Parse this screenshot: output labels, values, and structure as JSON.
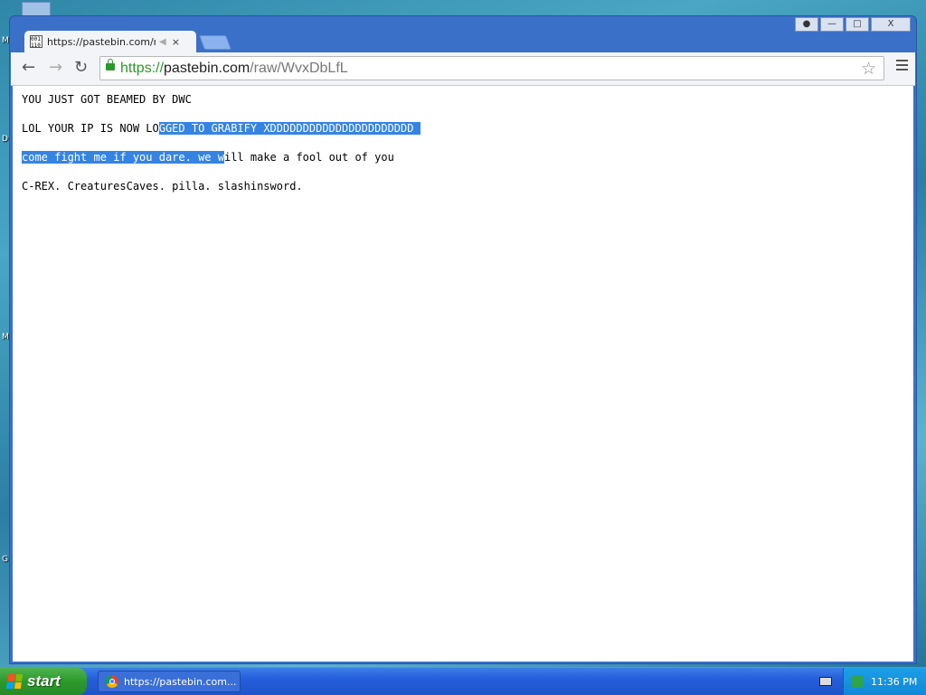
{
  "desktop": {
    "side_labels": [
      "M",
      "D",
      "M",
      "G"
    ]
  },
  "browser": {
    "tab": {
      "title": "https://pastebin.com/raw/WvxDbLfL",
      "favicon_text": "001 110",
      "audio_icon": "speaker-icon",
      "close_symbol": "×"
    },
    "window_controls": {
      "user": "user-icon",
      "minimize": "—",
      "maximize": "□",
      "close": "X"
    },
    "address": {
      "scheme": "https://",
      "host": "pastebin.com",
      "path": "/raw/WvxDbLfL"
    },
    "nav": {
      "back": "←",
      "forward": "→",
      "reload": "↻",
      "star": "☆"
    }
  },
  "page": {
    "line1": "YOU JUST GOT BEAMED BY DWC",
    "line2_plain": "LOL YOUR IP IS NOW LO",
    "line2_selected": "GGED TO GRABIFY XDDDDDDDDDDDDDDDDDDDDDD ",
    "line3_selected": "come fight me if you dare. we w",
    "line3_plain": "ill make a fool out of you",
    "line4": "C-REX. CreaturesCaves. pilla. slashinsword."
  },
  "taskbar": {
    "start_label": "start",
    "task_label": "https://pastebin.com...",
    "clock": "11:36 PM"
  },
  "colors": {
    "selection": "#3584e4",
    "taskbar": "#245edb",
    "start": "#2c9a2c"
  }
}
